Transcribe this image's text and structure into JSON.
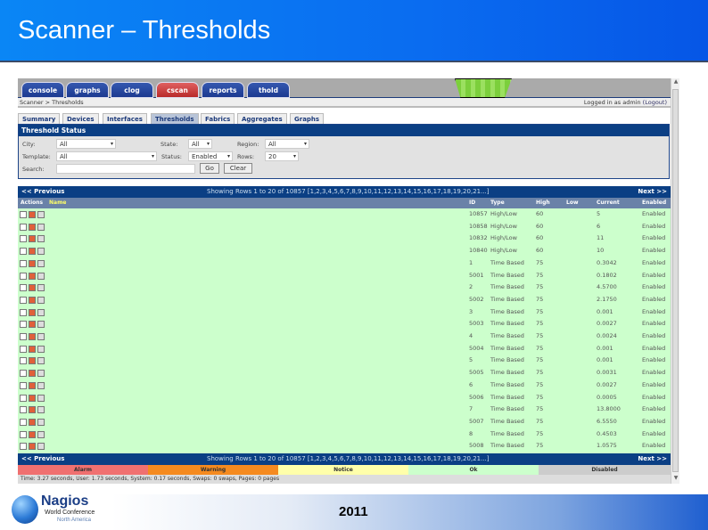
{
  "slide": {
    "title": "Scanner – Thresholds",
    "year": "2011",
    "logo": {
      "name": "Nagios",
      "line1": "World Conference",
      "line2": "North America"
    }
  },
  "nav_tabs": [
    {
      "label": "console"
    },
    {
      "label": "graphs"
    },
    {
      "label": "clog"
    },
    {
      "label": "cscan",
      "active": true
    },
    {
      "label": "reports"
    },
    {
      "label": "thold"
    }
  ],
  "breadcrumb": "Scanner > Thresholds",
  "login": {
    "text": "Logged in as admin",
    "logout": "(Logout)"
  },
  "sub_tabs": [
    {
      "label": "Summary"
    },
    {
      "label": "Devices"
    },
    {
      "label": "Interfaces"
    },
    {
      "label": "Thresholds",
      "active": true
    },
    {
      "label": "Fabrics"
    },
    {
      "label": "Aggregates"
    },
    {
      "label": "Graphs"
    }
  ],
  "filter": {
    "title": "Threshold Status",
    "city_label": "City:",
    "city": "All",
    "state_label": "State:",
    "state": "All",
    "region_label": "Region:",
    "region": "All",
    "template_label": "Template:",
    "template": "All",
    "status_label": "Status:",
    "status": "Enabled",
    "rows_label": "Rows:",
    "rows": "20",
    "search_label": "Search:",
    "search_value": "",
    "go": "Go",
    "clear": "Clear"
  },
  "pager": {
    "prev": "<< Previous",
    "next": "Next >>",
    "info": "Showing Rows 1 to 20 of 10857 [1,2,3,4,5,6,7,8,9,10,11,12,13,14,15,16,17,18,19,20,21...]"
  },
  "columns": {
    "actions": "Actions",
    "name": "Name",
    "id": "ID",
    "type": "Type",
    "high": "High",
    "low": "Low",
    "current": "Current",
    "enabled": "Enabled"
  },
  "rows": [
    {
      "id": "10857",
      "type": "High/Low",
      "high": "60",
      "low": "",
      "current": "5",
      "enabled": "Enabled"
    },
    {
      "id": "10858",
      "type": "High/Low",
      "high": "60",
      "low": "",
      "current": "6",
      "enabled": "Enabled"
    },
    {
      "id": "10832",
      "type": "High/Low",
      "high": "60",
      "low": "",
      "current": "11",
      "enabled": "Enabled"
    },
    {
      "id": "10840",
      "type": "High/Low",
      "high": "60",
      "low": "",
      "current": "10",
      "enabled": "Enabled"
    },
    {
      "id": "1",
      "type": "Time Based",
      "high": "75",
      "low": "",
      "current": "0.3042",
      "enabled": "Enabled"
    },
    {
      "id": "5001",
      "type": "Time Based",
      "high": "75",
      "low": "",
      "current": "0.1802",
      "enabled": "Enabled"
    },
    {
      "id": "2",
      "type": "Time Based",
      "high": "75",
      "low": "",
      "current": "4.5700",
      "enabled": "Enabled"
    },
    {
      "id": "5002",
      "type": "Time Based",
      "high": "75",
      "low": "",
      "current": "2.1750",
      "enabled": "Enabled"
    },
    {
      "id": "3",
      "type": "Time Based",
      "high": "75",
      "low": "",
      "current": "0.001",
      "enabled": "Enabled"
    },
    {
      "id": "5003",
      "type": "Time Based",
      "high": "75",
      "low": "",
      "current": "0.0027",
      "enabled": "Enabled"
    },
    {
      "id": "4",
      "type": "Time Based",
      "high": "75",
      "low": "",
      "current": "0.0024",
      "enabled": "Enabled"
    },
    {
      "id": "5004",
      "type": "Time Based",
      "high": "75",
      "low": "",
      "current": "0.001",
      "enabled": "Enabled"
    },
    {
      "id": "5",
      "type": "Time Based",
      "high": "75",
      "low": "",
      "current": "0.001",
      "enabled": "Enabled"
    },
    {
      "id": "5005",
      "type": "Time Based",
      "high": "75",
      "low": "",
      "current": "0.0031",
      "enabled": "Enabled"
    },
    {
      "id": "6",
      "type": "Time Based",
      "high": "75",
      "low": "",
      "current": "0.0027",
      "enabled": "Enabled"
    },
    {
      "id": "5006",
      "type": "Time Based",
      "high": "75",
      "low": "",
      "current": "0.0005",
      "enabled": "Enabled"
    },
    {
      "id": "7",
      "type": "Time Based",
      "high": "75",
      "low": "",
      "current": "13.8000",
      "enabled": "Enabled"
    },
    {
      "id": "5007",
      "type": "Time Based",
      "high": "75",
      "low": "",
      "current": "6.5550",
      "enabled": "Enabled"
    },
    {
      "id": "8",
      "type": "Time Based",
      "high": "75",
      "low": "",
      "current": "0.4503",
      "enabled": "Enabled"
    },
    {
      "id": "5008",
      "type": "Time Based",
      "high": "75",
      "low": "",
      "current": "1.0575",
      "enabled": "Enabled"
    }
  ],
  "legend": [
    {
      "label": "Alarm",
      "color": "#f07070"
    },
    {
      "label": "Warning",
      "color": "#f58a1f"
    },
    {
      "label": "Notice",
      "color": "#ffffaa"
    },
    {
      "label": "Ok",
      "color": "#ccffcc"
    },
    {
      "label": "Disabled",
      "color": "#cccccc"
    }
  ],
  "stats": "Time: 3.27 seconds, User: 1.73 seconds, System: 0.17 seconds, Swaps: 0 swaps, Pages: 0 pages"
}
